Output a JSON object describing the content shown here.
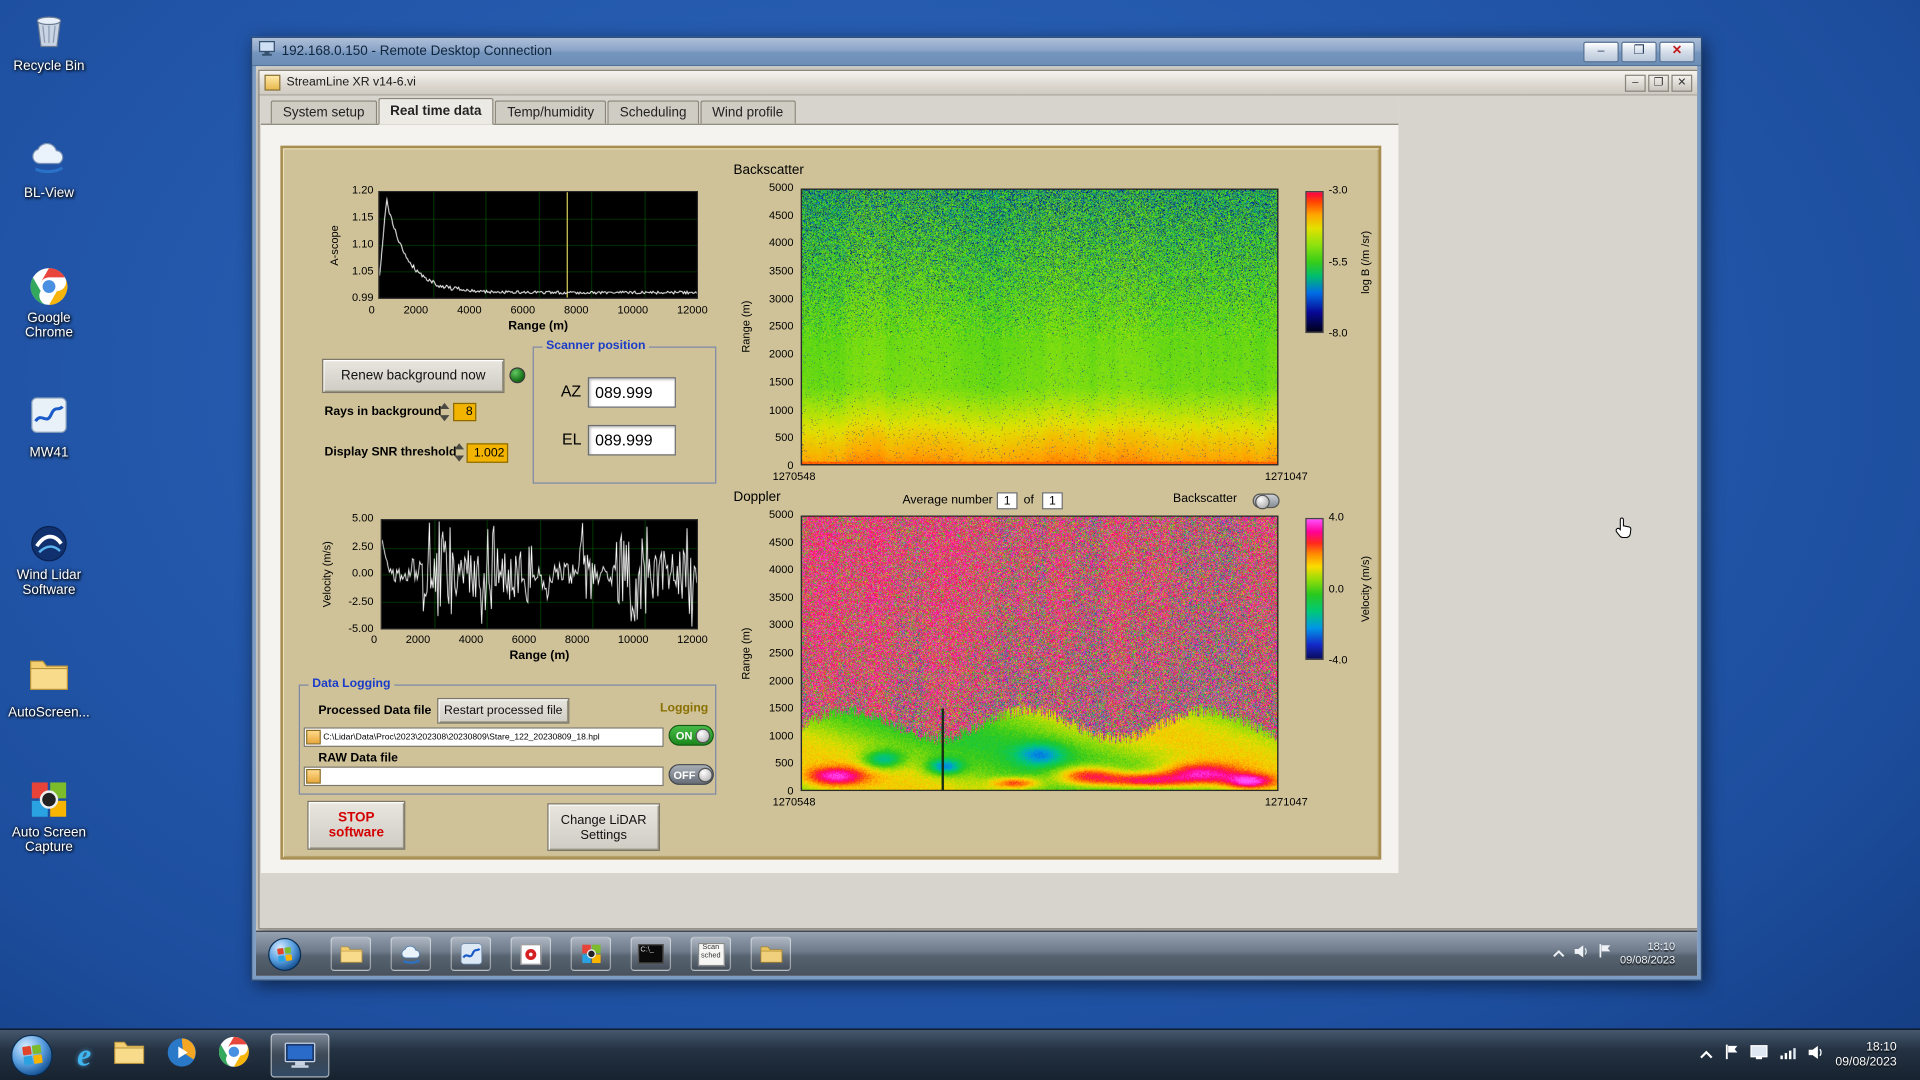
{
  "desktop": {
    "icons": [
      {
        "label": "Recycle Bin"
      },
      {
        "label": "BL-View"
      },
      {
        "label": "Google Chrome"
      },
      {
        "label": "MW41"
      },
      {
        "label": "Wind Lidar Software"
      },
      {
        "label": "AutoScreen..."
      },
      {
        "label": "Auto Screen Capture"
      }
    ]
  },
  "rdp": {
    "title": "192.168.0.150 - Remote Desktop Connection",
    "controls": {
      "minimize": "–",
      "maximize": "❐",
      "close": "✕"
    }
  },
  "app": {
    "title": "StreamLine XR v14-6.vi",
    "controls": {
      "minimize": "–",
      "maximize": "❐",
      "close": "✕"
    },
    "tabs": [
      {
        "label": "System setup",
        "active": false
      },
      {
        "label": "Real time data",
        "active": true
      },
      {
        "label": "Temp/humidity",
        "active": false
      },
      {
        "label": "Scheduling",
        "active": false
      },
      {
        "label": "Wind profile",
        "active": false
      }
    ],
    "background_controls": {
      "renew_button": "Renew background now",
      "rays_label": "Rays in background",
      "rays_value": "8",
      "snr_label": "Display SNR threshold",
      "snr_value": "1.002"
    },
    "scanner": {
      "title": "Scanner position",
      "az_label": "AZ",
      "az_value": "089.999",
      "el_label": "EL",
      "el_value": "089.999"
    },
    "doppler_header": {
      "average_label": "Average number",
      "average_value": "1",
      "of_label": "of",
      "of_value": "1",
      "backscatter_label": "Backscatter"
    },
    "logging": {
      "title": "Data Logging",
      "processed_label": "Processed Data file",
      "restart_button": "Restart processed file",
      "logging_label": "Logging",
      "processed_path": "C:\\Lidar\\Data\\Proc\\2023\\202308\\20230809\\Stare_122_20230809_18.hpl",
      "on_label": "ON",
      "raw_label": "RAW Data file",
      "raw_path": "",
      "off_label": "OFF"
    },
    "actions": {
      "stop_button": "STOP software",
      "settings_button": "Change LiDAR Settings"
    }
  },
  "remote_taskbar": {
    "scan_icon_line1": "Scan",
    "scan_icon_line2": "sched",
    "time": "18:10",
    "date": "09/08/2023"
  },
  "taskbar": {
    "ie_glyph": "e",
    "time": "18:10",
    "date": "09/08/2023"
  },
  "chart_data": [
    {
      "id": "ascope",
      "type": "line",
      "ylabel": "A-scope",
      "xlabel": "Range (m)",
      "ylim": [
        0.99,
        1.2
      ],
      "xlim": [
        0,
        12000
      ],
      "yticks": [
        "1.20",
        "1.15",
        "1.10",
        "1.05",
        "0.99"
      ],
      "xticks": [
        "0",
        "2000",
        "4000",
        "6000",
        "8000",
        "10000",
        "12000"
      ],
      "cursor_x_m": 7100,
      "series": [
        {
          "name": "background amplitude",
          "shape": "rises to ~1.19 near 250 m, exponential decay to ~1.00 by 2500 m, flat noisy ~1.00 out to 12000 m"
        }
      ]
    },
    {
      "id": "backscatter",
      "type": "heatmap",
      "title": "Backscatter",
      "ylabel": "Range (m)",
      "ylim": [
        0,
        5000
      ],
      "yticks": [
        "5000",
        "4500",
        "4000",
        "3500",
        "3000",
        "2500",
        "2000",
        "1500",
        "1000",
        "500",
        "0"
      ],
      "x_first": "1270548",
      "x_last": "1271047",
      "colorbar": {
        "label": "log B (/m /sr)",
        "ticks": [
          "-3.0",
          "-5.5",
          "-8.0"
        ],
        "min": -8,
        "max": -3
      },
      "features": "orange surface return at 0 m, yellow aerosol layer (~-4) below ~700 m, uniform green (~-5.2) up to ~2500 m, speckled green/dark noise above"
    },
    {
      "id": "velocity",
      "type": "line",
      "ylabel": "Velocity (m/s)",
      "xlabel": "Range (m)",
      "ylim": [
        -5,
        5
      ],
      "xlim": [
        0,
        12000
      ],
      "yticks": [
        "5.00",
        "2.50",
        "0.00",
        "-2.50",
        "-5.00"
      ],
      "xticks": [
        "0",
        "2000",
        "4000",
        "6000",
        "8000",
        "10000",
        "12000"
      ],
      "series": [
        {
          "name": "radial velocity",
          "shape": "±1 m/s coherent signal below ~1500 m, saturated ±5 m/s noise bursts beyond"
        }
      ]
    },
    {
      "id": "doppler",
      "type": "heatmap",
      "title": "Doppler",
      "ylabel": "Range (m)",
      "ylim": [
        0,
        5000
      ],
      "yticks": [
        "5000",
        "4500",
        "4000",
        "3500",
        "3000",
        "2500",
        "2000",
        "1500",
        "1000",
        "500",
        "0"
      ],
      "x_first": "1270548",
      "x_last": "1271047",
      "colorbar": {
        "label": "Velocity (m/s)",
        "ticks": [
          "4.0",
          "0.0",
          "-4.0"
        ],
        "min": -4,
        "max": 4
      },
      "features": "coherent green/yellow velocities below ~1300 m with red updraft patches near the surface and small blue pockets; uncorrelated magenta/green noise above"
    }
  ]
}
